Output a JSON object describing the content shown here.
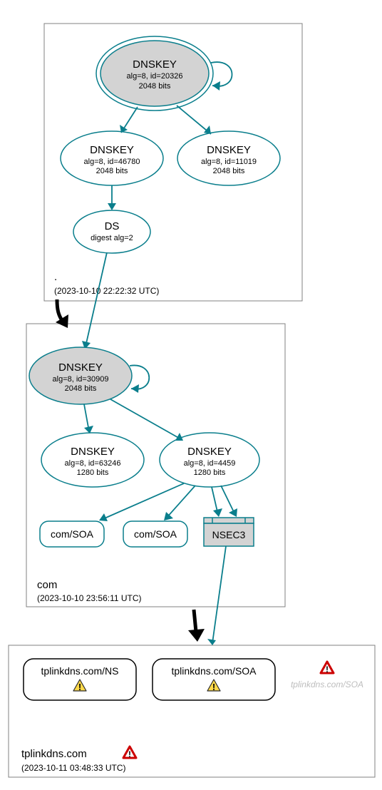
{
  "zones": {
    "root": {
      "label": ".",
      "ts": "(2023-10-10 22:22:32 UTC)"
    },
    "com": {
      "label": "com",
      "ts": "(2023-10-10 23:56:11 UTC)"
    },
    "tpl": {
      "label": "tplinkdns.com",
      "ts": "(2023-10-11 03:48:33 UTC)"
    }
  },
  "root": {
    "ksk": {
      "title": "DNSKEY",
      "alg": "alg=8, id=20326",
      "bits": "2048 bits"
    },
    "zsk1": {
      "title": "DNSKEY",
      "alg": "alg=8, id=46780",
      "bits": "2048 bits"
    },
    "zsk2": {
      "title": "DNSKEY",
      "alg": "alg=8, id=11019",
      "bits": "2048 bits"
    },
    "ds": {
      "title": "DS",
      "alg": "digest alg=2"
    }
  },
  "com": {
    "ksk": {
      "title": "DNSKEY",
      "alg": "alg=8, id=30909",
      "bits": "2048 bits"
    },
    "zsk1": {
      "title": "DNSKEY",
      "alg": "alg=8, id=63246",
      "bits": "1280 bits"
    },
    "zsk2": {
      "title": "DNSKEY",
      "alg": "alg=8, id=4459",
      "bits": "1280 bits"
    },
    "soa1": {
      "label": "com/SOA"
    },
    "soa2": {
      "label": "com/SOA"
    },
    "nsec": {
      "label": "NSEC3"
    }
  },
  "tpl": {
    "ns": {
      "label": "tplinkdns.com/NS"
    },
    "soa": {
      "label": "tplinkdns.com/SOA"
    },
    "soa_ghost": {
      "label": "tplinkdns.com/SOA"
    }
  }
}
